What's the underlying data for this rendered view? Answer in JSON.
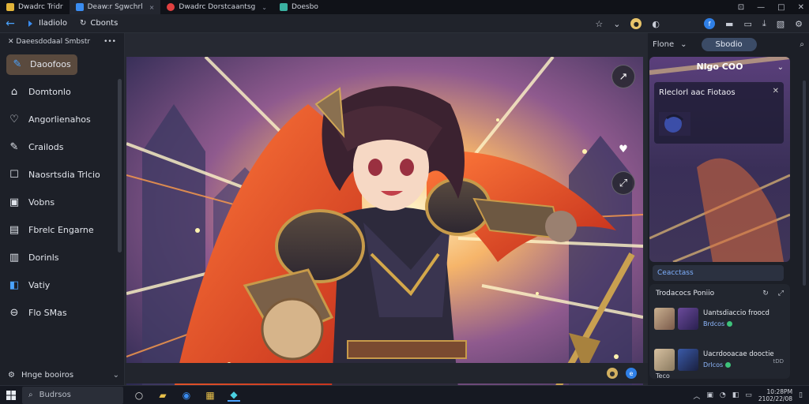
{
  "tabs": [
    {
      "label": "Dwadrc Tridr",
      "color": "#e2b43a"
    },
    {
      "label": "Deaw:r Sgwchrl",
      "color": "#3a8cf0",
      "close": "×"
    },
    {
      "label": "Dwadrc Dorstcaantsg",
      "color": "#e04040",
      "close": "⌄"
    },
    {
      "label": "Doesbo",
      "color": "#3ab0a0"
    }
  ],
  "window_controls": {
    "minimize": "—",
    "maximize": "□",
    "close": "✕",
    "pin": "⊡"
  },
  "toolbar": {
    "back_glyph": "←",
    "crumbs": [
      {
        "label": "Iladiolo",
        "icon": "chevron-icon"
      },
      {
        "label": "Cbonts",
        "icon": "refresh-icon"
      }
    ]
  },
  "sidebar": {
    "header": "Daeesdodaal Smbstr",
    "more": "•••",
    "items": [
      {
        "label": "Daoofoos",
        "icon": "✎",
        "active": true
      },
      {
        "label": "Domtonlo",
        "icon": "⌂"
      },
      {
        "label": "Angorlienahos",
        "icon": "♡"
      },
      {
        "label": "Crailods",
        "icon": "✎"
      },
      {
        "label": "Naosrtsdia Trlcio",
        "icon": "☐"
      },
      {
        "label": "Vobns",
        "icon": "▣"
      },
      {
        "label": "Fbrelc Engarne",
        "icon": "▤"
      },
      {
        "label": "Dorinls",
        "icon": "▥"
      },
      {
        "label": "Vatiy",
        "icon": "◧"
      },
      {
        "label": "Flo SMas",
        "icon": "⊖"
      }
    ],
    "footer": "Hnge booiros"
  },
  "right_panel": {
    "sort_label": "Flone",
    "action_button": "Sbodio",
    "card_title": "Nlgo COO",
    "sub_title": "Rleclorl aac Fiotaos",
    "link_button": "Ceacctass",
    "friends_header": "Trodacocs  Poniio",
    "friends": [
      {
        "name": "Uantsdiaccio froocd",
        "status": "Brdcos"
      },
      {
        "name": "Uacrdooacae dooctie",
        "status": "Drlcos",
        "tag": "tDD"
      }
    ],
    "friend_label": "Teco"
  },
  "taskbar": {
    "search_placeholder": "Budrsos",
    "clock_time": "10:28PM",
    "clock_date": "2102/22/08"
  },
  "colors": {
    "accent": "#4aa3ff",
    "active_item": "#5a4a3e",
    "online": "#3ec27b"
  }
}
